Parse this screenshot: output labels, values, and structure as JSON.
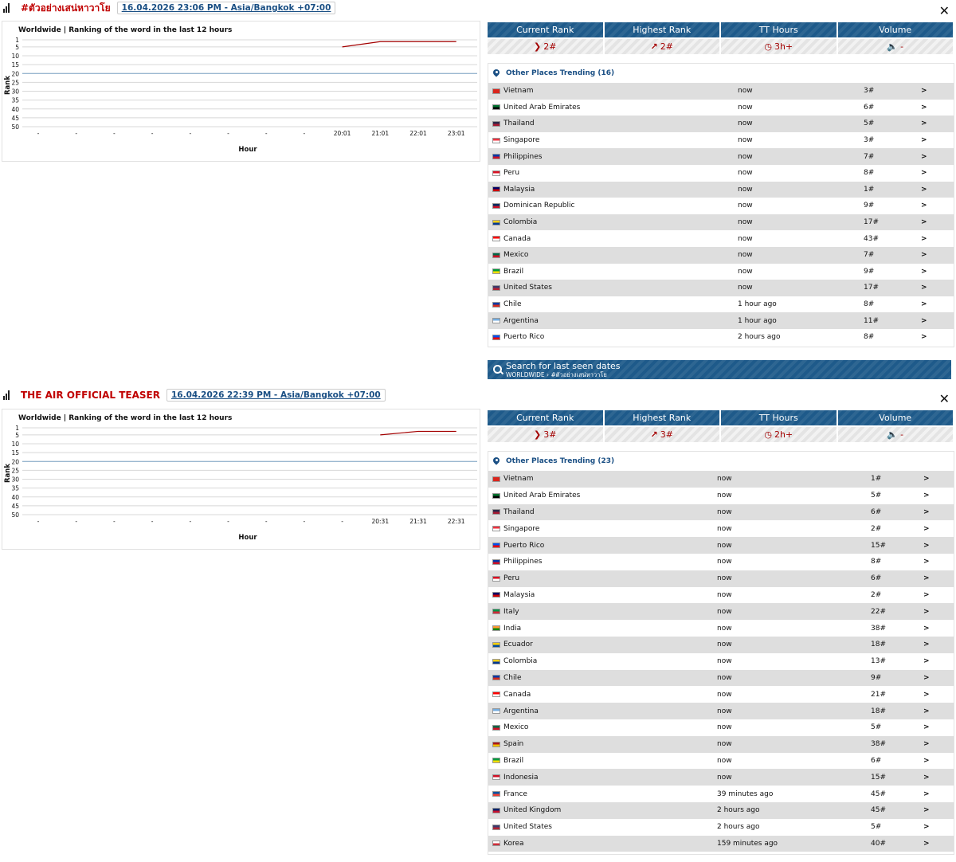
{
  "panels": [
    {
      "title": "#ตัวอย่างเสน่หาวาโย",
      "datetime": "16.04.2026 23:06 PM - Asia/Bangkok +07:00",
      "close": "✕",
      "chart_title": "Worldwide | Ranking of the word in the last 12 hours",
      "chart_data": {
        "type": "line",
        "title": "Worldwide | Ranking of the word in the last 12 hours",
        "xlabel": "Hour",
        "ylabel": "Rank",
        "categories": [
          "-",
          "-",
          "-",
          "-",
          "-",
          "-",
          "-",
          "-",
          "20:01",
          "21:01",
          "22:01",
          "23:01"
        ],
        "yticks": [
          1,
          5,
          10,
          15,
          20,
          25,
          30,
          35,
          40,
          45,
          50
        ],
        "ylim": [
          1,
          50
        ],
        "y_inverted": true,
        "reference_line": 20,
        "series": [
          {
            "values": [
              null,
              null,
              null,
              null,
              null,
              null,
              null,
              null,
              5,
              2,
              2,
              2
            ]
          }
        ]
      },
      "stats": [
        {
          "label": "Current Rank",
          "icon": "chevrons-right-icon",
          "glyph": "❯",
          "value": "2#"
        },
        {
          "label": "Highest Rank",
          "icon": "trending-up-icon",
          "glyph": "↗",
          "value": "2#"
        },
        {
          "label": "TT Hours",
          "icon": "clock-icon",
          "glyph": "◷",
          "value": "3h+"
        },
        {
          "label": "Volume",
          "icon": "volume-icon",
          "glyph": "🔈",
          "value": "-"
        }
      ],
      "places_title": "Other Places Trending (16)",
      "places": [
        {
          "country": "Vietnam",
          "time": "now",
          "rank": "3#",
          "flag": [
            "#da251d",
            "#da251d"
          ]
        },
        {
          "country": "United Arab Emirates",
          "time": "now",
          "rank": "6#",
          "flag": [
            "#00732f",
            "#000000"
          ]
        },
        {
          "country": "Thailand",
          "time": "now",
          "rank": "5#",
          "flag": [
            "#2d2a4a",
            "#a51931"
          ]
        },
        {
          "country": "Singapore",
          "time": "now",
          "rank": "3#",
          "flag": [
            "#ef3340",
            "#ffffff"
          ]
        },
        {
          "country": "Philippines",
          "time": "now",
          "rank": "7#",
          "flag": [
            "#0038a8",
            "#ce1126"
          ]
        },
        {
          "country": "Peru",
          "time": "now",
          "rank": "8#",
          "flag": [
            "#d91023",
            "#ffffff"
          ]
        },
        {
          "country": "Malaysia",
          "time": "now",
          "rank": "1#",
          "flag": [
            "#010066",
            "#cc0001"
          ]
        },
        {
          "country": "Dominican Republic",
          "time": "now",
          "rank": "9#",
          "flag": [
            "#002d62",
            "#ce1126"
          ]
        },
        {
          "country": "Colombia",
          "time": "now",
          "rank": "17#",
          "flag": [
            "#fcd116",
            "#003893"
          ]
        },
        {
          "country": "Canada",
          "time": "now",
          "rank": "43#",
          "flag": [
            "#ff0000",
            "#ffffff"
          ]
        },
        {
          "country": "Mexico",
          "time": "now",
          "rank": "7#",
          "flag": [
            "#006847",
            "#ce1126"
          ]
        },
        {
          "country": "Brazil",
          "time": "now",
          "rank": "9#",
          "flag": [
            "#009c3b",
            "#ffdf00"
          ]
        },
        {
          "country": "United States",
          "time": "now",
          "rank": "17#",
          "flag": [
            "#3c3b6e",
            "#b22234"
          ]
        },
        {
          "country": "Chile",
          "time": "1 hour ago",
          "rank": "8#",
          "flag": [
            "#0039a6",
            "#d52b1e"
          ]
        },
        {
          "country": "Argentina",
          "time": "1 hour ago",
          "rank": "11#",
          "flag": [
            "#74acdf",
            "#ffffff"
          ]
        },
        {
          "country": "Puerto Rico",
          "time": "2 hours ago",
          "rank": "8#",
          "flag": [
            "#0050f0",
            "#ed0000"
          ]
        }
      ],
      "search_label": "Search for last seen dates",
      "search_path": "WORLDWIDE › #ตัวอย่างเสน่หาวาโย"
    },
    {
      "title": "THE AIR OFFICIAL TEASER",
      "datetime": "16.04.2026 22:39 PM - Asia/Bangkok +07:00",
      "close": "✕",
      "chart_title": "Worldwide | Ranking of the word in the last 12 hours",
      "chart_data": {
        "type": "line",
        "title": "Worldwide | Ranking of the word in the last 12 hours",
        "xlabel": "Hour",
        "ylabel": "Rank",
        "categories": [
          "-",
          "-",
          "-",
          "-",
          "-",
          "-",
          "-",
          "-",
          "-",
          "20:31",
          "21:31",
          "22:31"
        ],
        "yticks": [
          1,
          5,
          10,
          15,
          20,
          25,
          30,
          35,
          40,
          45,
          50
        ],
        "ylim": [
          1,
          50
        ],
        "y_inverted": true,
        "reference_line": 20,
        "series": [
          {
            "values": [
              null,
              null,
              null,
              null,
              null,
              null,
              null,
              null,
              null,
              5,
              3,
              3
            ]
          }
        ]
      },
      "stats": [
        {
          "label": "Current Rank",
          "icon": "chevrons-right-icon",
          "glyph": "❯",
          "value": "3#"
        },
        {
          "label": "Highest Rank",
          "icon": "trending-up-icon",
          "glyph": "↗",
          "value": "3#"
        },
        {
          "label": "TT Hours",
          "icon": "clock-icon",
          "glyph": "◷",
          "value": "2h+"
        },
        {
          "label": "Volume",
          "icon": "volume-icon",
          "glyph": "🔈",
          "value": "-"
        }
      ],
      "places_title": "Other Places Trending (23)",
      "places": [
        {
          "country": "Vietnam",
          "time": "now",
          "rank": "1#",
          "flag": [
            "#da251d",
            "#da251d"
          ]
        },
        {
          "country": "United Arab Emirates",
          "time": "now",
          "rank": "5#",
          "flag": [
            "#00732f",
            "#000000"
          ]
        },
        {
          "country": "Thailand",
          "time": "now",
          "rank": "6#",
          "flag": [
            "#2d2a4a",
            "#a51931"
          ]
        },
        {
          "country": "Singapore",
          "time": "now",
          "rank": "2#",
          "flag": [
            "#ef3340",
            "#ffffff"
          ]
        },
        {
          "country": "Puerto Rico",
          "time": "now",
          "rank": "15#",
          "flag": [
            "#0050f0",
            "#ed0000"
          ]
        },
        {
          "country": "Philippines",
          "time": "now",
          "rank": "8#",
          "flag": [
            "#0038a8",
            "#ce1126"
          ]
        },
        {
          "country": "Peru",
          "time": "now",
          "rank": "6#",
          "flag": [
            "#d91023",
            "#ffffff"
          ]
        },
        {
          "country": "Malaysia",
          "time": "now",
          "rank": "2#",
          "flag": [
            "#010066",
            "#cc0001"
          ]
        },
        {
          "country": "Italy",
          "time": "now",
          "rank": "22#",
          "flag": [
            "#009246",
            "#ce2b37"
          ]
        },
        {
          "country": "India",
          "time": "now",
          "rank": "38#",
          "flag": [
            "#ff9933",
            "#138808"
          ]
        },
        {
          "country": "Ecuador",
          "time": "now",
          "rank": "18#",
          "flag": [
            "#ffd100",
            "#034ea2"
          ]
        },
        {
          "country": "Colombia",
          "time": "now",
          "rank": "13#",
          "flag": [
            "#fcd116",
            "#003893"
          ]
        },
        {
          "country": "Chile",
          "time": "now",
          "rank": "9#",
          "flag": [
            "#0039a6",
            "#d52b1e"
          ]
        },
        {
          "country": "Canada",
          "time": "now",
          "rank": "21#",
          "flag": [
            "#ff0000",
            "#ffffff"
          ]
        },
        {
          "country": "Argentina",
          "time": "now",
          "rank": "18#",
          "flag": [
            "#74acdf",
            "#ffffff"
          ]
        },
        {
          "country": "Mexico",
          "time": "now",
          "rank": "5#",
          "flag": [
            "#006847",
            "#ce1126"
          ]
        },
        {
          "country": "Spain",
          "time": "now",
          "rank": "38#",
          "flag": [
            "#aa151b",
            "#f1bf00"
          ]
        },
        {
          "country": "Brazil",
          "time": "now",
          "rank": "6#",
          "flag": [
            "#009c3b",
            "#ffdf00"
          ]
        },
        {
          "country": "Indonesia",
          "time": "now",
          "rank": "15#",
          "flag": [
            "#ce1126",
            "#ffffff"
          ]
        },
        {
          "country": "France",
          "time": "39 minutes ago",
          "rank": "45#",
          "flag": [
            "#0055a4",
            "#ef4135"
          ]
        },
        {
          "country": "United Kingdom",
          "time": "2 hours ago",
          "rank": "45#",
          "flag": [
            "#012169",
            "#c8102e"
          ]
        },
        {
          "country": "United States",
          "time": "2 hours ago",
          "rank": "5#",
          "flag": [
            "#3c3b6e",
            "#b22234"
          ]
        },
        {
          "country": "Korea",
          "time": "159 minutes ago",
          "rank": "40#",
          "flag": [
            "#ffffff",
            "#cd2e3a"
          ]
        }
      ]
    }
  ],
  "row_arrow": ">",
  "colors": {
    "accent": "#1e5a8a",
    "title_red": "#c00000",
    "line": "#a30000",
    "link": "#1a4f84",
    "ref_line": "#7ea6c8"
  }
}
